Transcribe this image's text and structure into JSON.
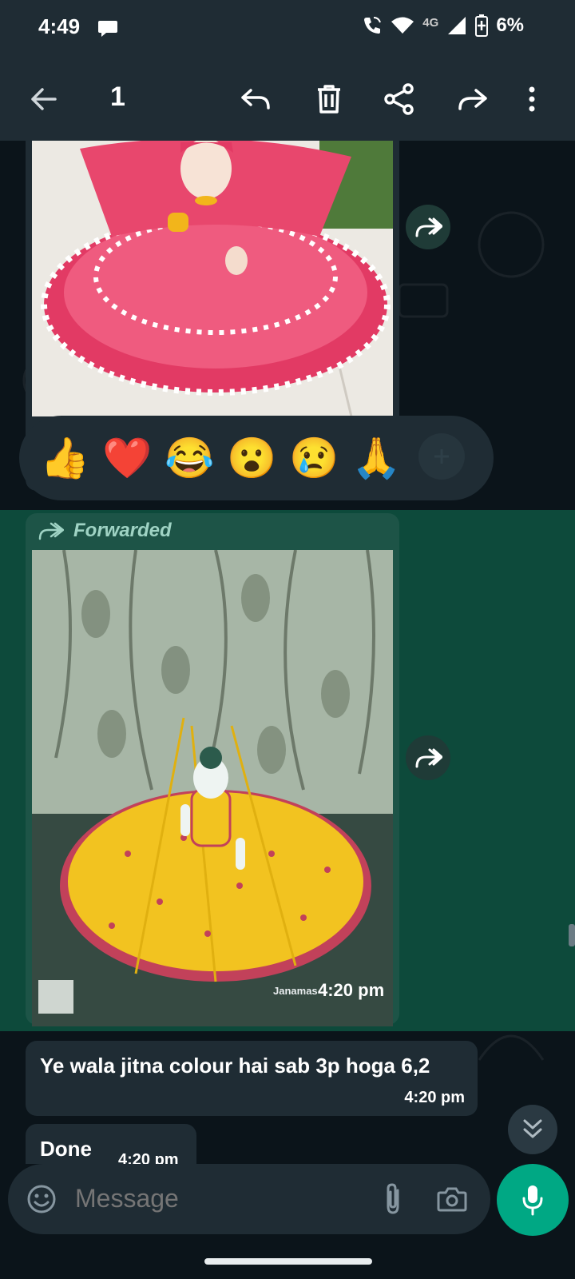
{
  "status": {
    "time": "4:49",
    "network": "4G",
    "battery": "6%"
  },
  "app_bar": {
    "selected_count": "1"
  },
  "messages": {
    "forwarded_label": "Forwarded",
    "image2_watermark": "Janamas",
    "image2_time": "4:20 pm",
    "msg1_text": "Ye wala jitna colour hai sab 3p hoga 6,2",
    "msg1_time": "4:20 pm",
    "msg2_text": "Done",
    "msg2_time": "4:20 pm"
  },
  "reactions": [
    "👍",
    "❤️",
    "😂",
    "😮",
    "😢",
    "🙏"
  ],
  "input": {
    "placeholder": "Message"
  },
  "colors": {
    "accent": "#00a884",
    "selected": "#0d4a3b",
    "bubble": "#1f2c34",
    "bar": "#1f2c34"
  }
}
